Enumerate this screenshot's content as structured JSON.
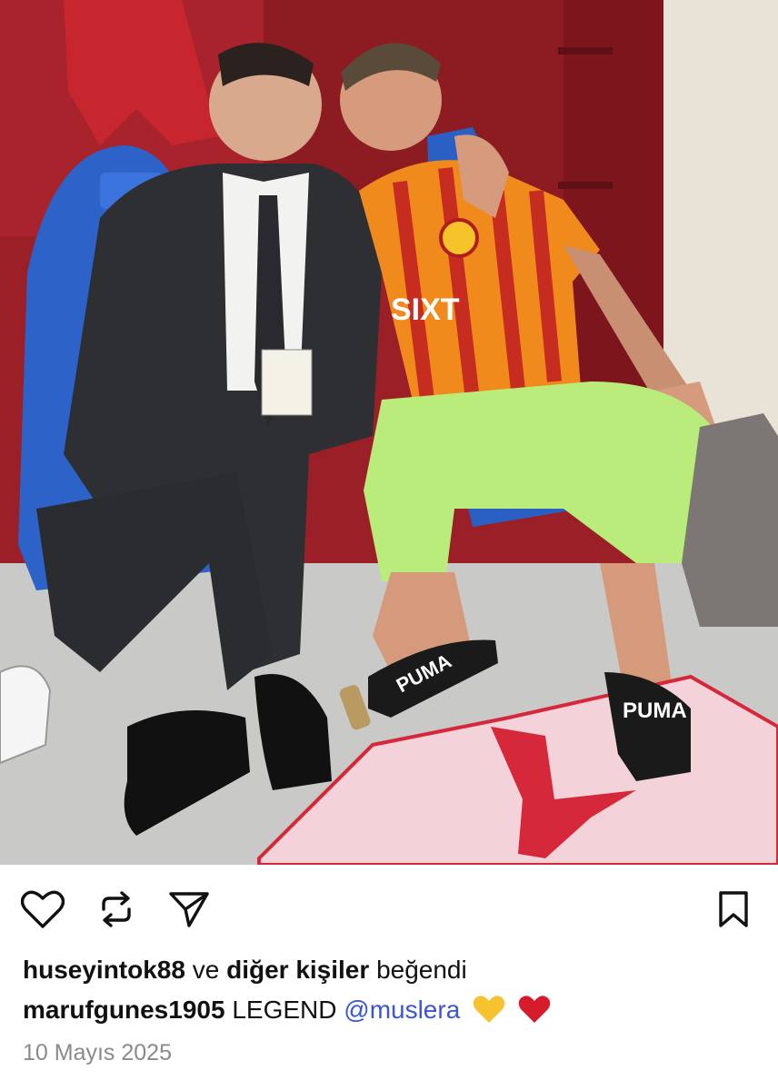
{
  "post": {
    "image_description_icon": "photo",
    "actions": {
      "like_icon": "heart-icon",
      "repost_icon": "repost-icon",
      "share_icon": "send-icon",
      "save_icon": "bookmark-icon"
    },
    "likes": {
      "user": "huseyintok88",
      "connector": "ve",
      "others": "diğer kişiler",
      "suffix": "beğendi"
    },
    "caption": {
      "user": "marufgunes1905",
      "text": "LEGEND",
      "mention": "@muslera",
      "emojis": [
        "yellow-heart",
        "red-heart"
      ]
    },
    "date": "10 Mayıs 2025"
  },
  "colors": {
    "mention": "#3a55d6",
    "date": "#8a8a8a",
    "yellow_heart": "#f7c22f",
    "red_heart": "#d81b2c"
  }
}
